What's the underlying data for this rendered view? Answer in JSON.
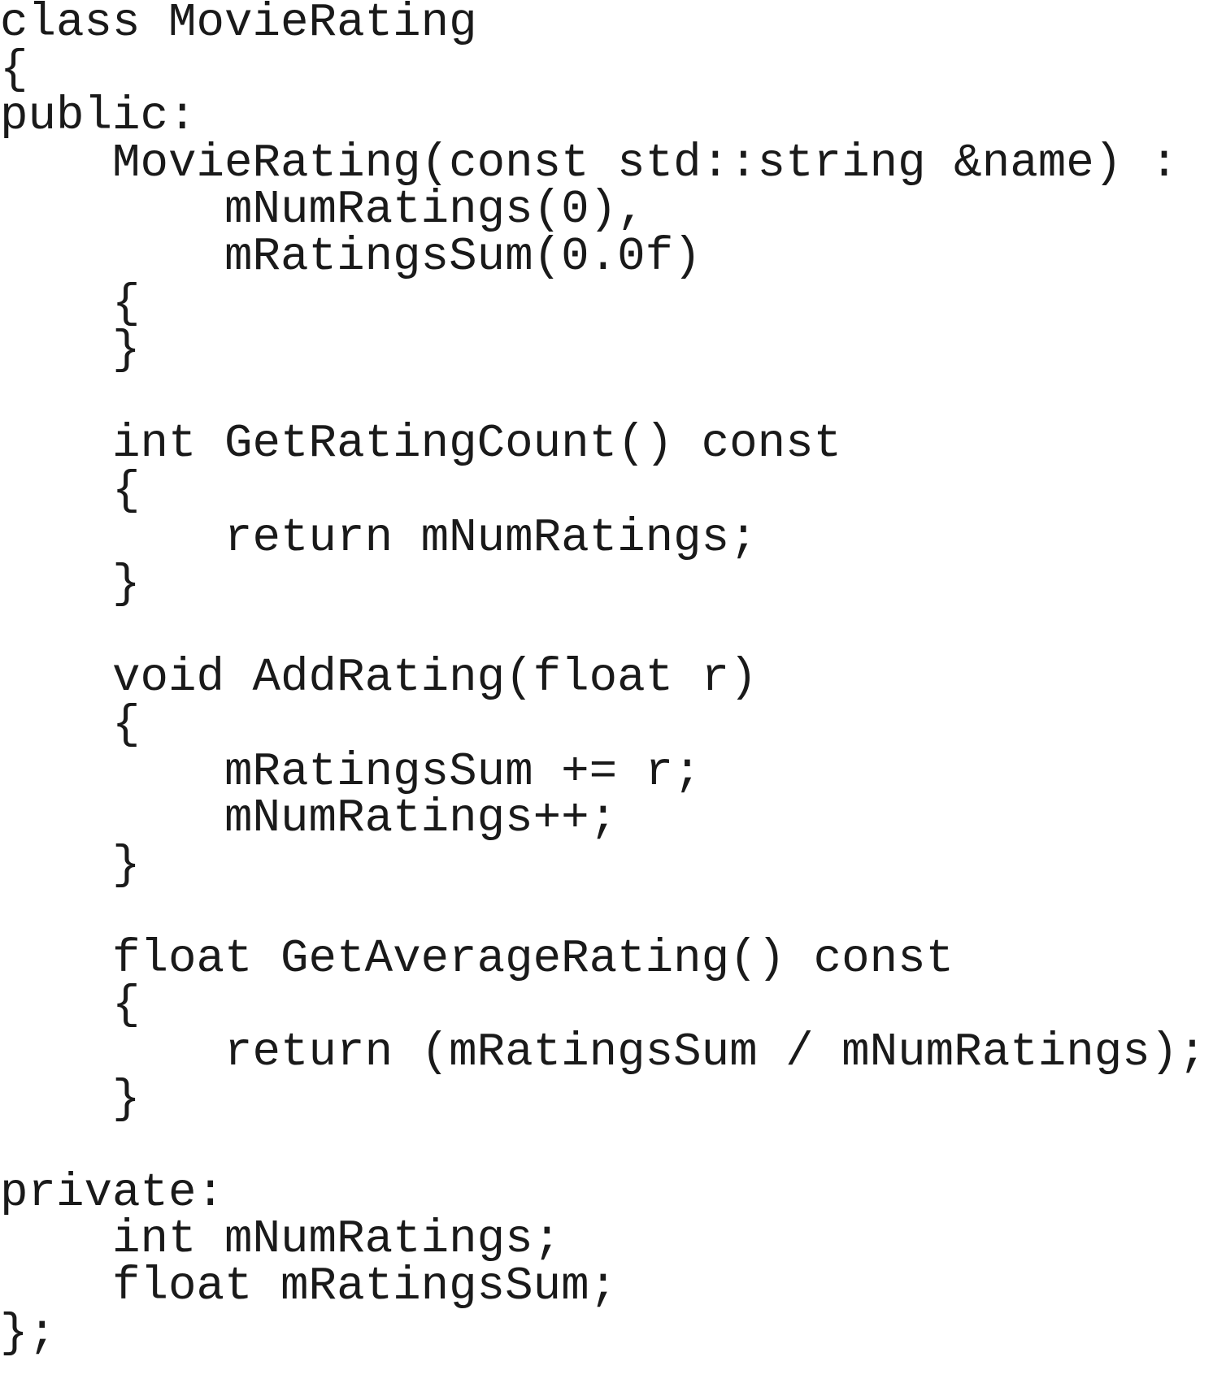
{
  "code": {
    "lines": [
      "class MovieRating",
      "{",
      "public:",
      "    MovieRating(const std::string &name) :",
      "        mNumRatings(0),",
      "        mRatingsSum(0.0f)",
      "    {",
      "    }",
      "",
      "    int GetRatingCount() const",
      "    {",
      "        return mNumRatings;",
      "    }",
      "",
      "    void AddRating(float r)",
      "    {",
      "        mRatingsSum += r;",
      "        mNumRatings++;",
      "    }",
      "",
      "    float GetAverageRating() const",
      "    {",
      "        return (mRatingsSum / mNumRatings);",
      "    }",
      "",
      "private:",
      "    int mNumRatings;",
      "    float mRatingsSum;",
      "};"
    ]
  }
}
